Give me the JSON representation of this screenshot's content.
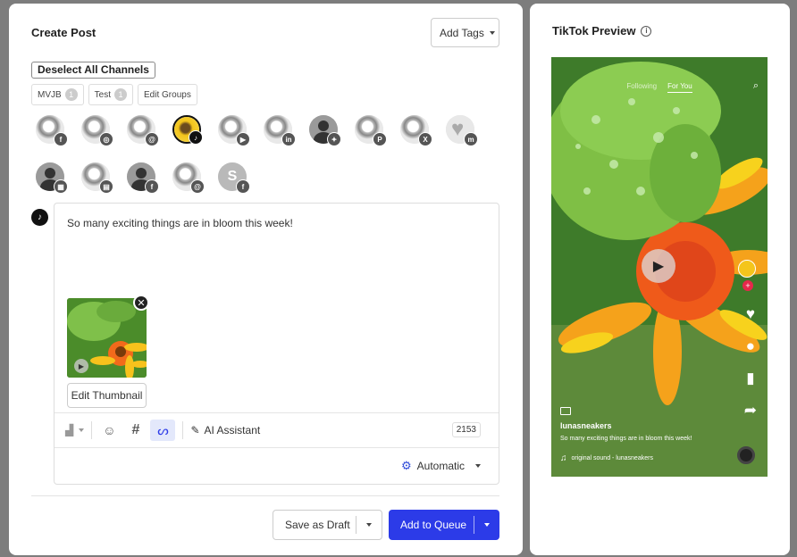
{
  "create_post": {
    "title": "Create Post",
    "add_tags_label": "Add Tags",
    "deselect_label": "Deselect All Channels",
    "groups": [
      {
        "label": "MVJB",
        "count": "1"
      },
      {
        "label": "Test",
        "count": "1"
      }
    ],
    "edit_groups_label": "Edit Groups",
    "channels_row1": [
      {
        "network": "facebook",
        "badge": "f",
        "style": "photo"
      },
      {
        "network": "instagram",
        "badge": "◎",
        "style": "photo"
      },
      {
        "network": "threads",
        "badge": "@",
        "style": "photo"
      },
      {
        "network": "tiktok",
        "badge": "♪",
        "style": "selected"
      },
      {
        "network": "youtube",
        "badge": "▶",
        "style": "photo"
      },
      {
        "network": "linkedin",
        "badge": "in",
        "style": "photo"
      },
      {
        "network": "bluesky",
        "badge": "✦",
        "style": "person"
      },
      {
        "network": "pinterest",
        "badge": "P",
        "style": "photo"
      },
      {
        "network": "x",
        "badge": "X",
        "style": "photo"
      },
      {
        "network": "mastodon",
        "badge": "m",
        "style": "heart"
      }
    ],
    "channels_row2": [
      {
        "network": "google-business",
        "badge": "▦",
        "style": "person"
      },
      {
        "network": "startpage",
        "badge": "▤",
        "style": "photo"
      },
      {
        "network": "facebook",
        "badge": "f",
        "style": "person"
      },
      {
        "network": "threads",
        "badge": "@",
        "style": "photo"
      },
      {
        "network": "facebook",
        "badge": "f",
        "style": "s",
        "initial": "S"
      }
    ],
    "post_text": "So many exciting things are in bloom this week!",
    "edit_thumbnail_label": "Edit Thumbnail",
    "ai_assistant_label": "AI Assistant",
    "char_count": "2153",
    "schedule_label": "Automatic",
    "save_draft_label": "Save as Draft",
    "add_to_queue_label": "Add to Queue"
  },
  "preview": {
    "title": "TikTok Preview",
    "tabs": {
      "following": "Following",
      "for_you": "For You"
    },
    "username": "lunasneakers",
    "caption": "So many exciting things are in bloom this week!",
    "sound": "original sound - lunasneakers"
  },
  "colors": {
    "primary": "#2c3be8",
    "schedule_gear": "#2f4bd9"
  }
}
